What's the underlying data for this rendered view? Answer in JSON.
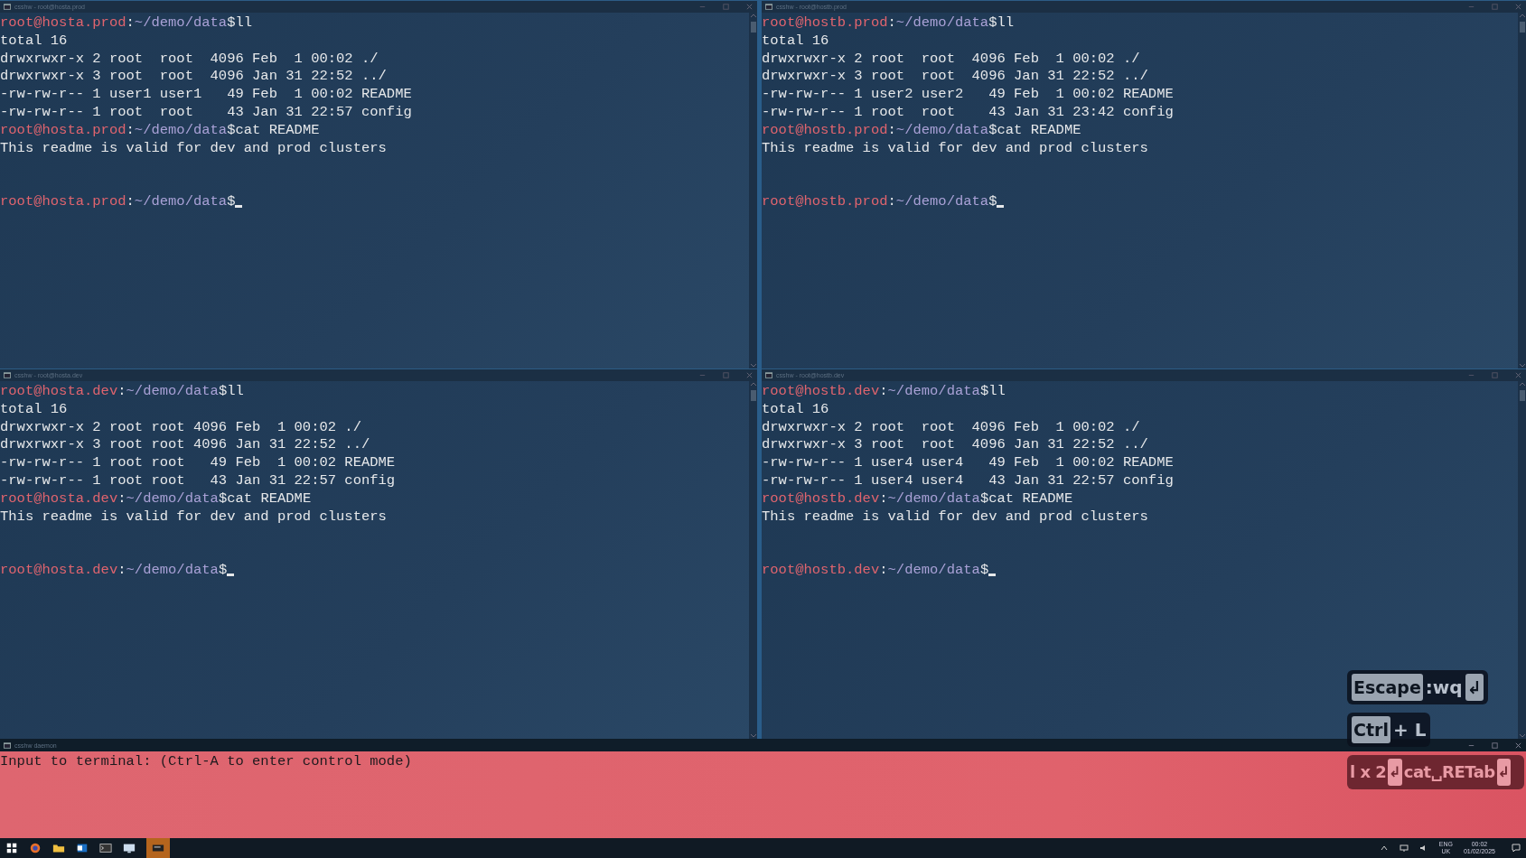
{
  "panes": [
    {
      "title": "csshw - root@hosta.prod",
      "lines": [
        {
          "kind": "prompt",
          "user": "root@hosta.prod",
          "separator": ":",
          "path": "~/demo/data",
          "symbol": "$",
          "command": "ll"
        },
        {
          "kind": "output",
          "text": "total 16"
        },
        {
          "kind": "output",
          "text": "drwxrwxr-x 2 root  root  4096 Feb  1 00:02 ./"
        },
        {
          "kind": "output",
          "text": "drwxrwxr-x 3 root  root  4096 Jan 31 22:52 ../"
        },
        {
          "kind": "output",
          "text": "-rw-rw-r-- 1 user1 user1   49 Feb  1 00:02 README"
        },
        {
          "kind": "output",
          "text": "-rw-rw-r-- 1 root  root    43 Jan 31 22:57 config"
        },
        {
          "kind": "prompt",
          "user": "root@hosta.prod",
          "separator": ":",
          "path": "~/demo/data",
          "symbol": "$",
          "command": "cat README"
        },
        {
          "kind": "output",
          "text": "This readme is valid for dev and prod clusters"
        },
        {
          "kind": "blank"
        },
        {
          "kind": "blank"
        },
        {
          "kind": "cursor",
          "user": "root@hosta.prod",
          "separator": ":",
          "path": "~/demo/data",
          "symbol": "$"
        }
      ]
    },
    {
      "title": "csshw - root@hostb.prod",
      "lines": [
        {
          "kind": "prompt",
          "user": "root@hostb.prod",
          "separator": ":",
          "path": "~/demo/data",
          "symbol": "$",
          "command": "ll"
        },
        {
          "kind": "output",
          "text": "total 16"
        },
        {
          "kind": "output",
          "text": "drwxrwxr-x 2 root  root  4096 Feb  1 00:02 ./"
        },
        {
          "kind": "output",
          "text": "drwxrwxr-x 3 root  root  4096 Jan 31 22:52 ../"
        },
        {
          "kind": "output",
          "text": "-rw-rw-r-- 1 user2 user2   49 Feb  1 00:02 README"
        },
        {
          "kind": "output",
          "text": "-rw-rw-r-- 1 root  root    43 Jan 31 23:42 config"
        },
        {
          "kind": "prompt",
          "user": "root@hostb.prod",
          "separator": ":",
          "path": "~/demo/data",
          "symbol": "$",
          "command": "cat README"
        },
        {
          "kind": "output",
          "text": "This readme is valid for dev and prod clusters"
        },
        {
          "kind": "blank"
        },
        {
          "kind": "blank"
        },
        {
          "kind": "cursor",
          "user": "root@hostb.prod",
          "separator": ":",
          "path": "~/demo/data",
          "symbol": "$"
        }
      ]
    },
    {
      "title": "csshw - root@hosta.dev",
      "lines": [
        {
          "kind": "prompt",
          "user": "root@hosta.dev",
          "separator": ":",
          "path": "~/demo/data",
          "symbol": "$",
          "command": "ll"
        },
        {
          "kind": "output",
          "text": "total 16"
        },
        {
          "kind": "output",
          "text": "drwxrwxr-x 2 root root 4096 Feb  1 00:02 ./"
        },
        {
          "kind": "output",
          "text": "drwxrwxr-x 3 root root 4096 Jan 31 22:52 ../"
        },
        {
          "kind": "output",
          "text": "-rw-rw-r-- 1 root root   49 Feb  1 00:02 README"
        },
        {
          "kind": "output",
          "text": "-rw-rw-r-- 1 root root   43 Jan 31 22:57 config"
        },
        {
          "kind": "prompt",
          "user": "root@hosta.dev",
          "separator": ":",
          "path": "~/demo/data",
          "symbol": "$",
          "command": "cat README"
        },
        {
          "kind": "output",
          "text": "This readme is valid for dev and prod clusters"
        },
        {
          "kind": "blank"
        },
        {
          "kind": "blank"
        },
        {
          "kind": "cursor",
          "user": "root@hosta.dev",
          "separator": ":",
          "path": "~/demo/data",
          "symbol": "$"
        }
      ]
    },
    {
      "title": "csshw - root@hostb.dev",
      "lines": [
        {
          "kind": "prompt",
          "user": "root@hostb.dev",
          "separator": ":",
          "path": "~/demo/data",
          "symbol": "$",
          "command": "ll"
        },
        {
          "kind": "output",
          "text": "total 16"
        },
        {
          "kind": "output",
          "text": "drwxrwxr-x 2 root  root  4096 Feb  1 00:02 ./"
        },
        {
          "kind": "output",
          "text": "drwxrwxr-x 3 root  root  4096 Jan 31 22:52 ../"
        },
        {
          "kind": "output",
          "text": "-rw-rw-r-- 1 user4 user4   49 Feb  1 00:02 README"
        },
        {
          "kind": "output",
          "text": "-rw-rw-r-- 1 user4 user4   43 Jan 31 22:57 config"
        },
        {
          "kind": "prompt",
          "user": "root@hostb.dev",
          "separator": ":",
          "path": "~/demo/data",
          "symbol": "$",
          "command": "cat README"
        },
        {
          "kind": "output",
          "text": "This readme is valid for dev and prod clusters"
        },
        {
          "kind": "blank"
        },
        {
          "kind": "blank"
        },
        {
          "kind": "cursor",
          "user": "root@hostb.dev",
          "separator": ":",
          "path": "~/demo/data",
          "symbol": "$"
        }
      ]
    }
  ],
  "daemon": {
    "title": "csshw daemon",
    "text": "Input to terminal: (Ctrl-A to enter control mode)"
  },
  "key_overlay": [
    {
      "kind": "dark",
      "parts": [
        {
          "kind": "key",
          "text": "Escape"
        },
        {
          "kind": "text",
          "text": ":wq"
        },
        {
          "kind": "key",
          "text": "↲"
        }
      ]
    },
    {
      "kind": "dark",
      "parts": [
        {
          "kind": "key",
          "text": "Ctrl"
        },
        {
          "kind": "text",
          "text": "+ L"
        }
      ]
    },
    {
      "kind": "red",
      "parts": [
        {
          "kind": "text",
          "text": "l x 2"
        },
        {
          "kind": "key",
          "text": "↲"
        },
        {
          "kind": "text",
          "text": "cat␣RETab"
        },
        {
          "kind": "key",
          "text": "↲"
        }
      ]
    }
  ],
  "taskbar": {
    "language": "ENG",
    "region": "UK",
    "time": "00:02",
    "date": "01/02/2025"
  }
}
